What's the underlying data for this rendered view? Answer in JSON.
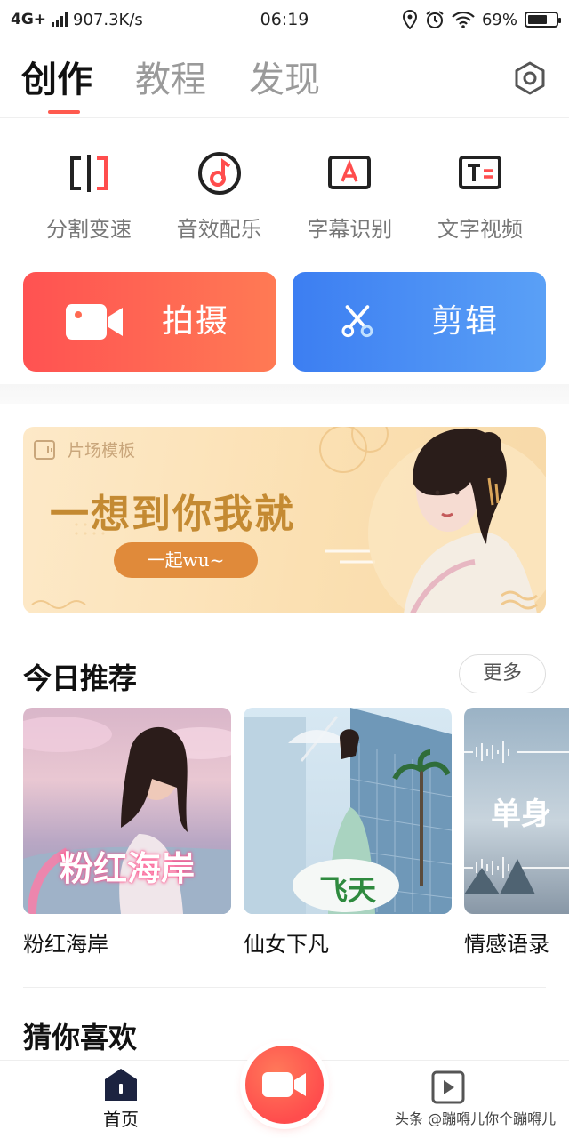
{
  "status_bar": {
    "network": "4G+",
    "speed": "907.3K/s",
    "time": "06:19",
    "battery": "69%",
    "battery_level": 0.69
  },
  "tabs": [
    {
      "label": "创作",
      "active": true
    },
    {
      "label": "教程",
      "active": false
    },
    {
      "label": "发现",
      "active": false
    }
  ],
  "tools": [
    {
      "label": "分割变速",
      "icon": "split-icon"
    },
    {
      "label": "音效配乐",
      "icon": "music-note-icon"
    },
    {
      "label": "字幕识别",
      "icon": "subtitle-icon"
    },
    {
      "label": "文字视频",
      "icon": "text-video-icon"
    }
  ],
  "actions": {
    "shoot_label": "拍摄",
    "edit_label": "剪辑"
  },
  "banner": {
    "tag": "片场模板",
    "title": "一想到你我就",
    "pill": "一起wu~"
  },
  "today": {
    "title": "今日推荐",
    "more": "更多",
    "items": [
      {
        "name": "粉红海岸",
        "overlay": "粉红海岸"
      },
      {
        "name": "仙女下凡",
        "overlay": "飞天"
      },
      {
        "name": "情感语录",
        "overlay": "单身"
      }
    ]
  },
  "guess": {
    "title": "猜你喜欢"
  },
  "bottom_nav": {
    "home_label": "首页"
  },
  "watermark": "头条 @蹦嘚儿你个蹦嘚儿",
  "colors": {
    "accent_red": "#ff5252",
    "accent_blue": "#3c7ef2",
    "banner_gold": "#c48a32"
  }
}
